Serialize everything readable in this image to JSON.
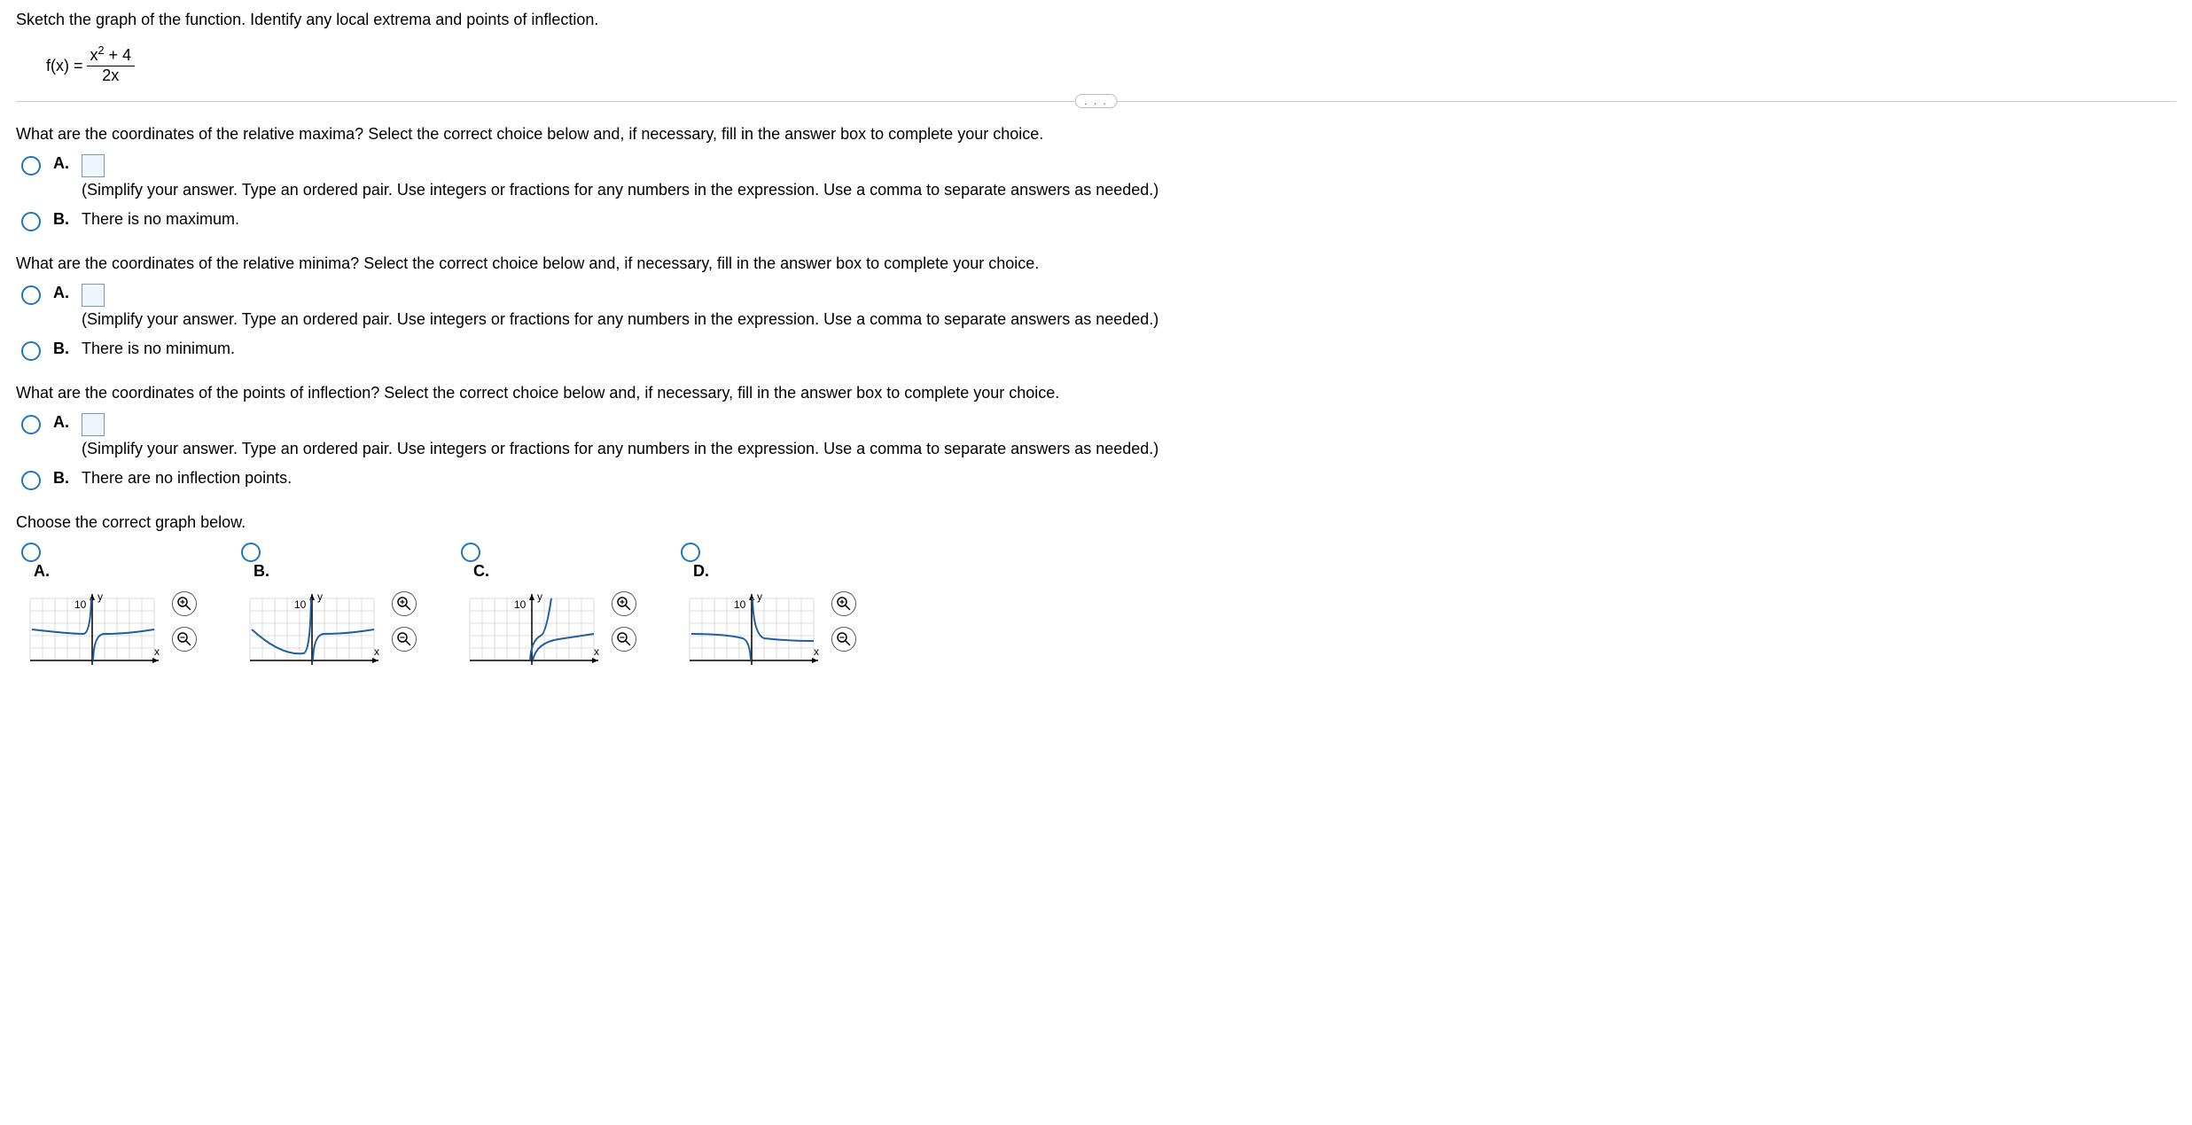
{
  "header": {
    "prompt": "Sketch the graph of the function. Identify any local extrema and points of inflection.",
    "formula_lhs": "f(x) =",
    "formula_num": "x² + 4",
    "formula_den": "2x"
  },
  "hr_badge": ". . .",
  "q1": {
    "text": "What are the coordinates of the relative maxima? Select the correct choice below and, if necessary, fill in the answer box to complete your choice.",
    "A_letter": "A.",
    "A_hint": "(Simplify your answer. Type an ordered pair. Use integers or fractions for any numbers in the expression. Use a comma to separate answers as needed.)",
    "B_letter": "B.",
    "B_text": "There is no maximum."
  },
  "q2": {
    "text": "What are the coordinates of the relative minima? Select the correct choice below and, if necessary, fill in the answer box to complete your choice.",
    "A_letter": "A.",
    "A_hint": "(Simplify your answer. Type an ordered pair. Use integers or fractions for any numbers in the expression. Use a comma to separate answers as needed.)",
    "B_letter": "B.",
    "B_text": "There is no minimum."
  },
  "q3": {
    "text": "What are the coordinates of the points of inflection? Select the correct choice below and, if necessary, fill in the answer box to complete your choice.",
    "A_letter": "A.",
    "A_hint": "(Simplify your answer. Type an ordered pair. Use integers or fractions for any numbers in the expression. Use a comma to separate answers as needed.)",
    "B_letter": "B.",
    "B_text": "There are no inflection points."
  },
  "q4": {
    "text": "Choose the correct graph below.",
    "A": "A.",
    "B": "B.",
    "C": "C.",
    "D": "D.",
    "y_label": "y",
    "x_label": "x",
    "y_tick": "10"
  }
}
